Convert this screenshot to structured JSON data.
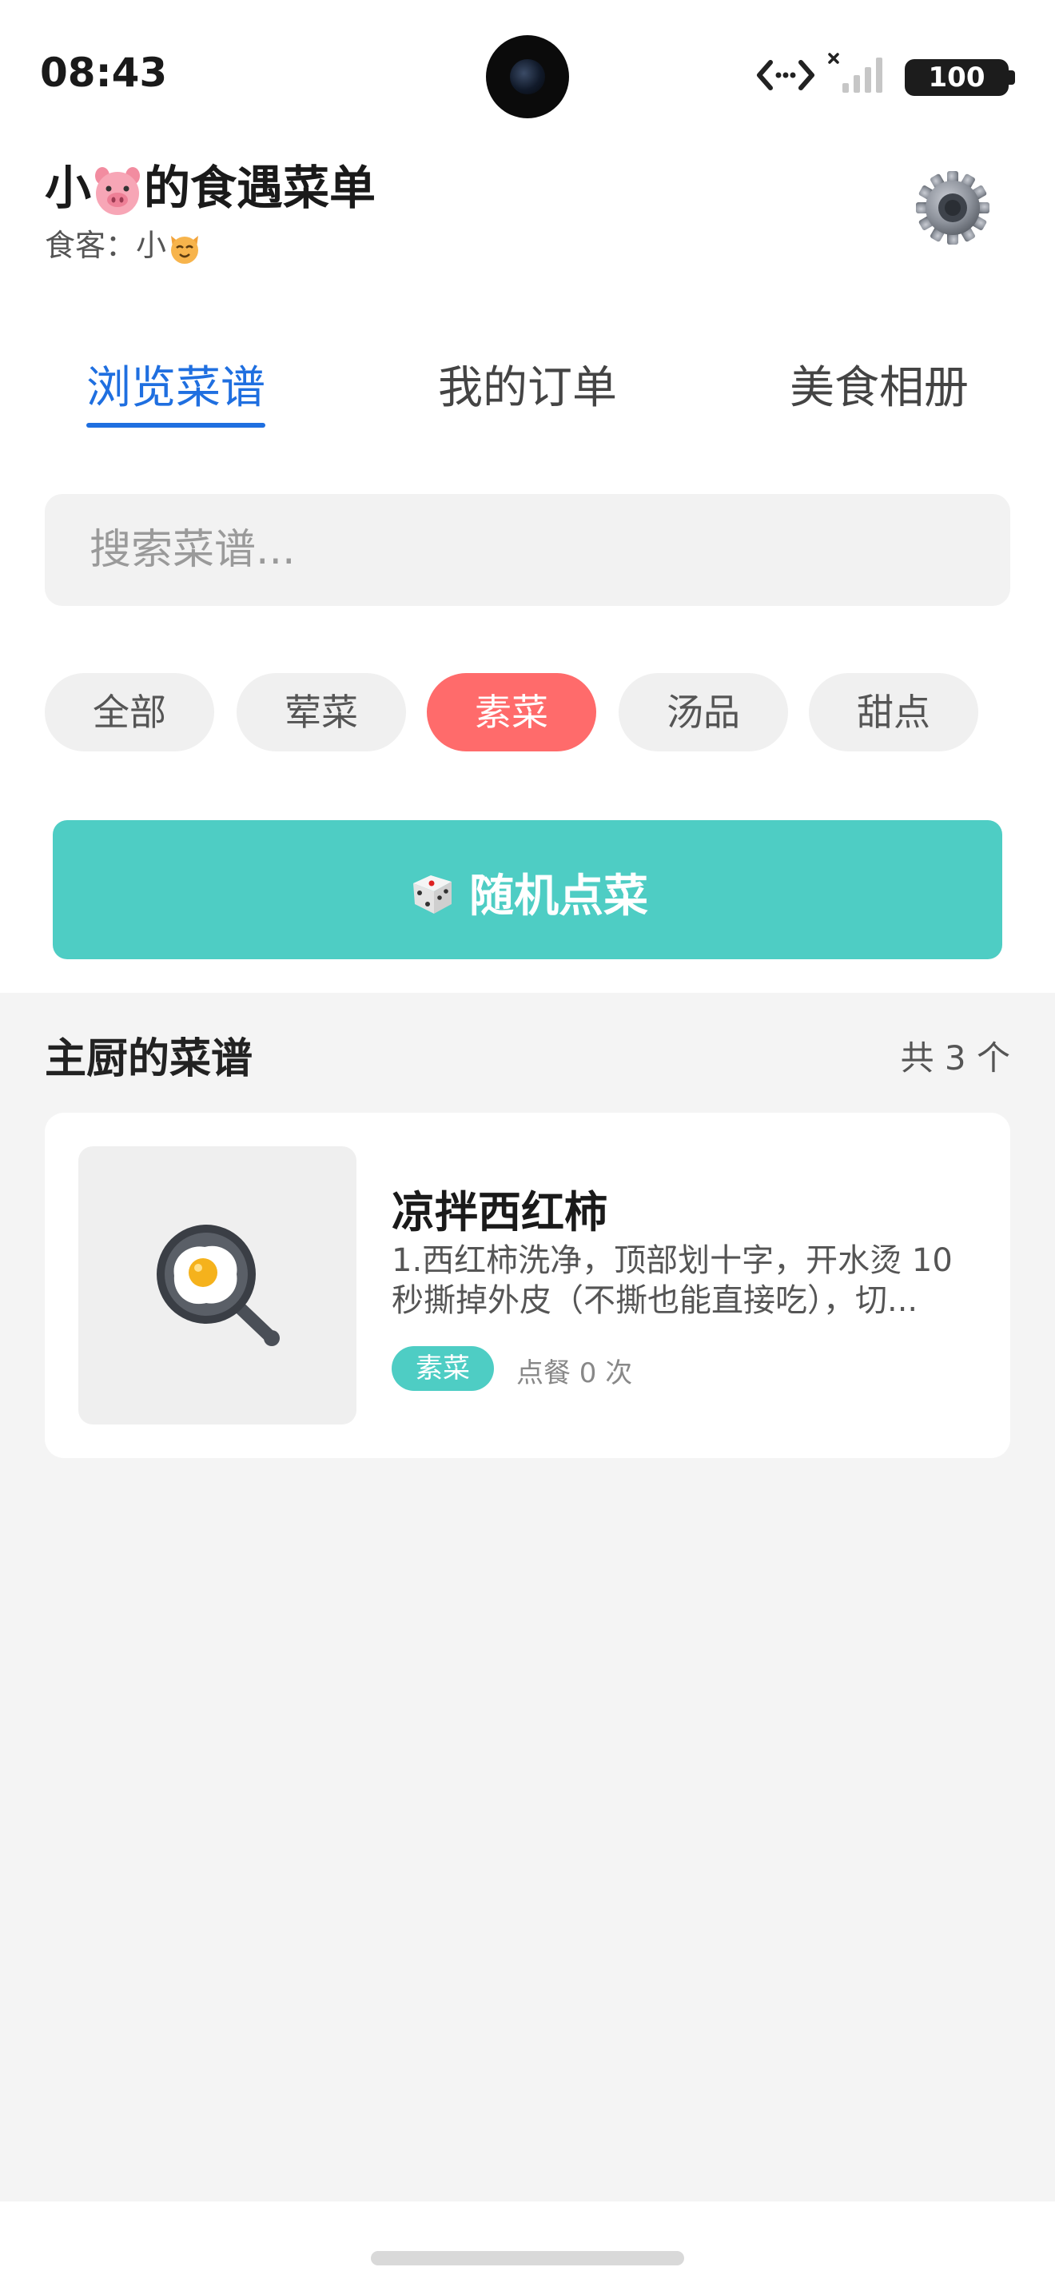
{
  "status_bar": {
    "time": "08:43",
    "battery": "100"
  },
  "header": {
    "title_prefix": "小",
    "title_emoji": "pig-face-icon",
    "title_suffix": "的食遇菜单",
    "subtitle_prefix": "食客：小",
    "subtitle_emoji": "cat-face-icon",
    "settings_icon": "gear-icon"
  },
  "tabs": [
    {
      "label": "浏览菜谱",
      "active": true
    },
    {
      "label": "我的订单",
      "active": false
    },
    {
      "label": "美食相册",
      "active": false
    }
  ],
  "search": {
    "placeholder": "搜索菜谱...",
    "value": ""
  },
  "categories": [
    {
      "label": "全部",
      "active": false
    },
    {
      "label": "荤菜",
      "active": false
    },
    {
      "label": "素菜",
      "active": true
    },
    {
      "label": "汤品",
      "active": false
    },
    {
      "label": "甜点",
      "active": false
    }
  ],
  "random_button": {
    "icon": "dice-icon",
    "label": "随机点菜"
  },
  "recipes_section": {
    "title": "主厨的菜谱",
    "count": "共 3 个",
    "items": [
      {
        "name": "凉拌西红柿",
        "description": "1.西红柿洗净，顶部划十字，开水烫 10 秒撕掉外皮（不撕也能直接吃），切...",
        "tag": "素菜",
        "orders": "点餐 0 次",
        "thumbnail_icon": "frying-pan-egg-icon"
      }
    ]
  },
  "colors": {
    "accent_blue": "#1f6fe0",
    "chip_active": "#ff6b6b",
    "teal": "#4ecdc4",
    "section_bg": "#f4f4f4"
  }
}
